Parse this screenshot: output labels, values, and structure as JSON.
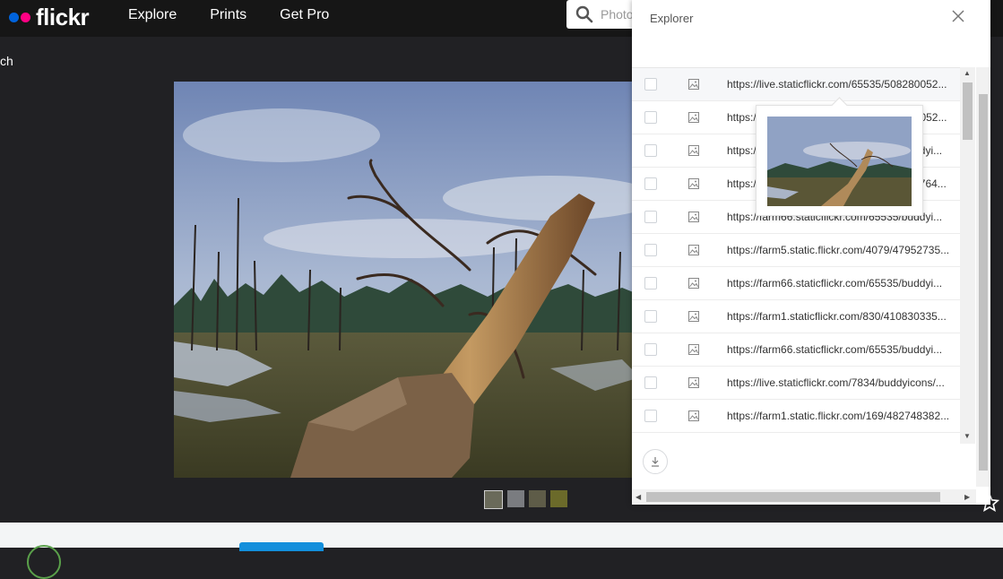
{
  "nav": {
    "logo": "flickr",
    "items": [
      "Explore",
      "Prints",
      "Get Pro"
    ],
    "search_placeholder": "Photo"
  },
  "back_text": "ch",
  "panel": {
    "title": "Explorer",
    "urls": [
      "https://live.staticflickr.com/65535/508280052...",
      "https://live.staticflickr.com/65535/508280052...",
      "https://farm66.staticflickr.com/65535/buddyi...",
      "https://farm66.staticflickr.com/65535/475764...",
      "https://farm66.staticflickr.com/65535/buddyi...",
      "https://farm5.static.flickr.com/4079/47952735...",
      "https://farm66.staticflickr.com/65535/buddyi...",
      "https://farm1.staticflickr.com/830/410830335...",
      "https://farm66.staticflickr.com/65535/buddyi...",
      "https://live.staticflickr.com/7834/buddyicons/...",
      "https://farm1.static.flickr.com/169/482748382..."
    ]
  },
  "colors": {
    "brand_blue": "#0063dc",
    "brand_pink": "#ff0084",
    "nav_bg": "#161616",
    "page_bg": "#212124"
  }
}
